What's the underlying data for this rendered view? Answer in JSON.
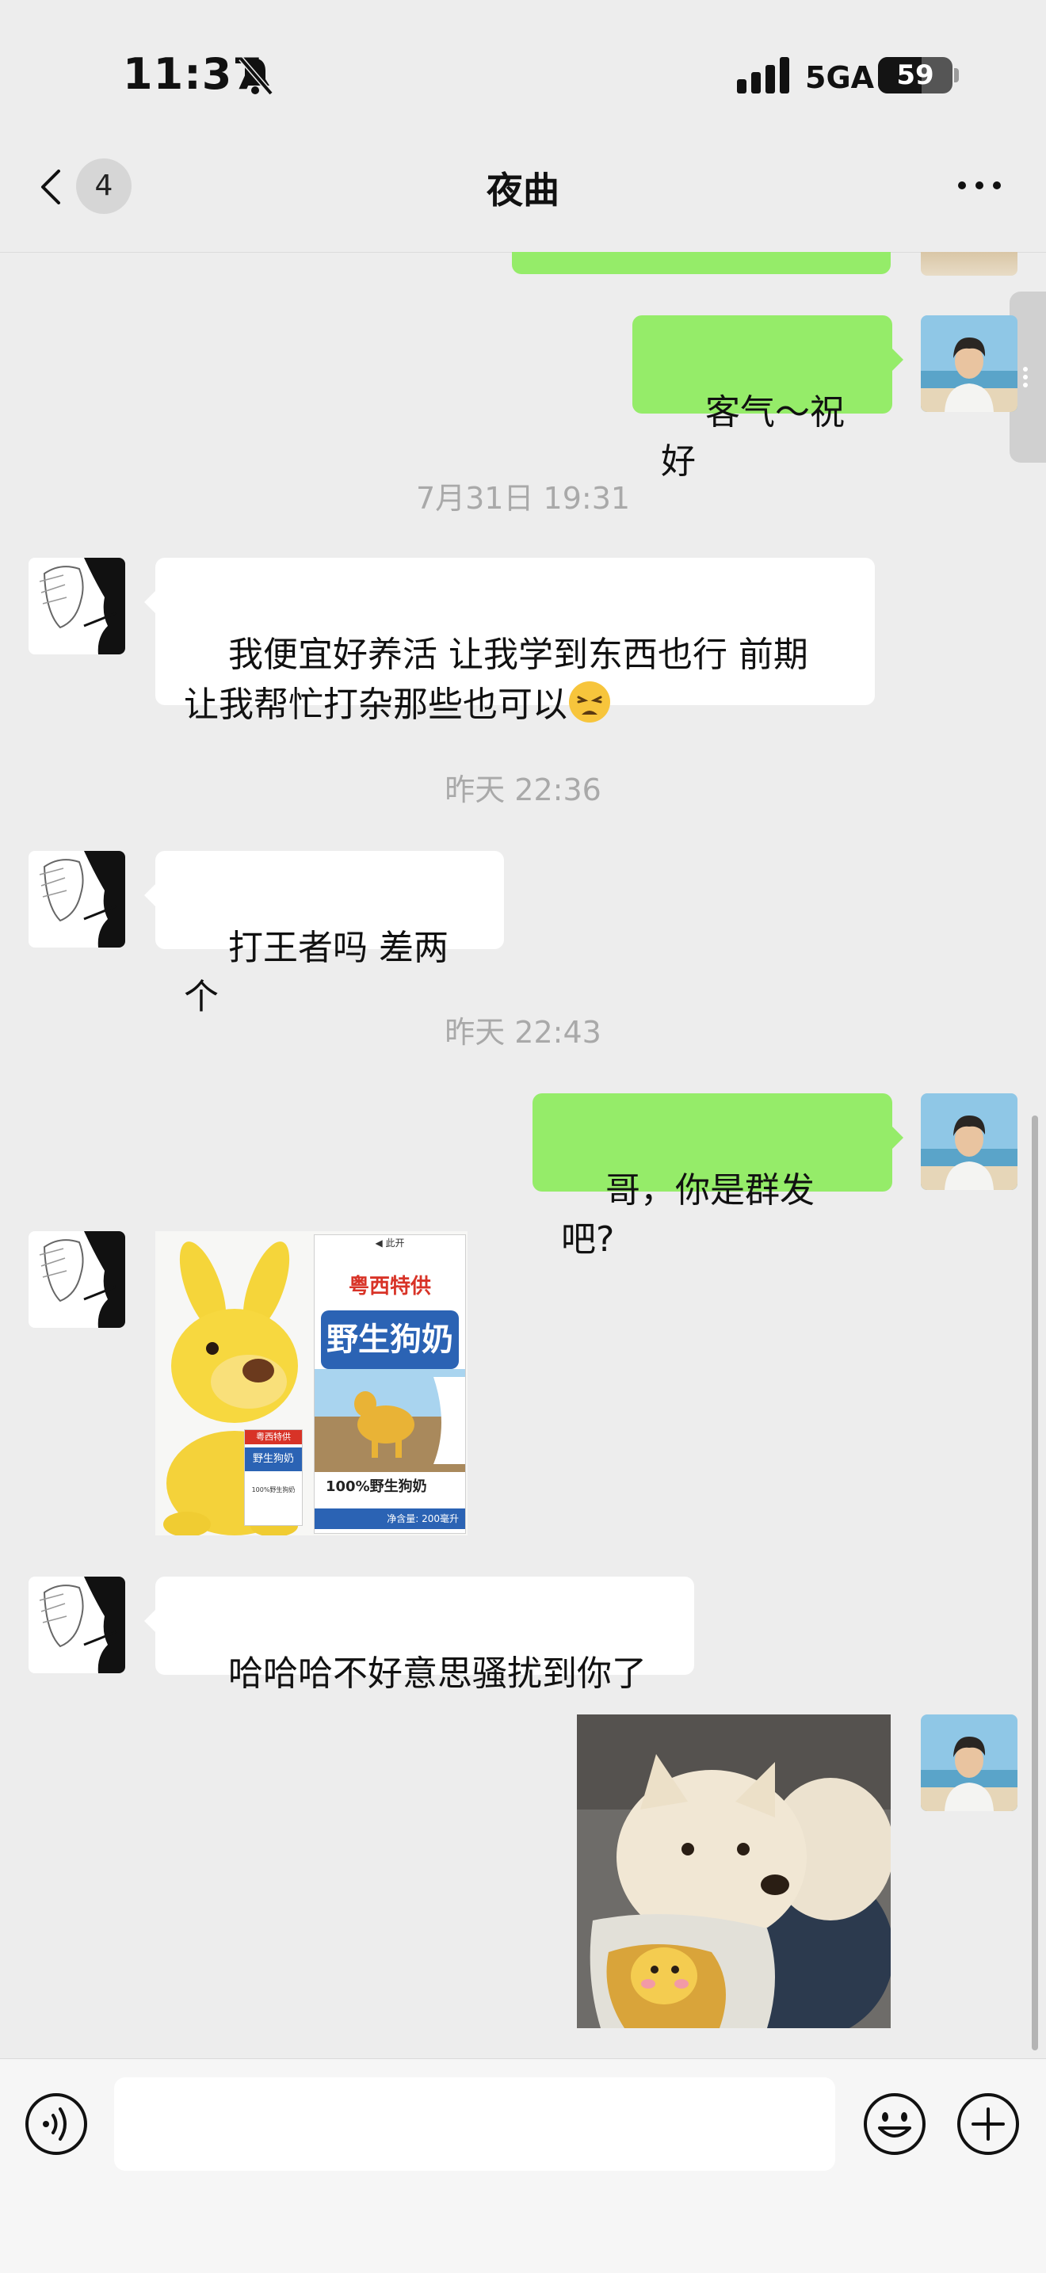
{
  "status_bar": {
    "time": "11:37",
    "network": "5GA",
    "battery_level": "59",
    "battery_fraction": 0.59
  },
  "nav": {
    "unread_count": "4",
    "title": "夜曲"
  },
  "messages": [
    {
      "side": "right",
      "type": "text",
      "text": ""
    },
    {
      "side": "right",
      "type": "text",
      "text": "客气～祝好"
    },
    {
      "type": "timestamp",
      "text": "7月31日 19:31"
    },
    {
      "side": "left",
      "type": "text",
      "text": "我便宜好养活 让我学到东西也行 前期\n让我帮忙打杂那些也可以",
      "emoji": "tired-face-emoji"
    },
    {
      "type": "timestamp",
      "text": "昨天 22:36"
    },
    {
      "side": "left",
      "type": "text",
      "text": "打王者吗 差两个"
    },
    {
      "type": "timestamp",
      "text": "昨天 22:43"
    },
    {
      "side": "right",
      "type": "text",
      "text": "哥，你是群发吧?"
    },
    {
      "side": "left",
      "type": "image",
      "image": {
        "brand": "粤西特供",
        "product": "野生狗奶",
        "percent_label": "100%野生狗奶",
        "volume": "净含量: 200毫升",
        "small_brand": "粤西特供",
        "small_product": "野生狗奶",
        "small_percent": "100%野生狗奶",
        "top_label": "◀ 此开"
      }
    },
    {
      "side": "left",
      "type": "text",
      "text": "哈哈哈不好意思骚扰到你了"
    },
    {
      "side": "right",
      "type": "image",
      "image": {
        "description_icon": "fluffy-dog-sticker"
      }
    }
  ],
  "input_bar": {
    "placeholder": ""
  },
  "icons": {
    "back": "chevron-left-icon",
    "more": "more-dots-icon",
    "mute": "bell-slash-icon",
    "voice": "voice-icon",
    "emoji": "smiley-icon",
    "plus": "plus-icon"
  },
  "colors": {
    "background": "#ededed",
    "bubble_green": "#95ec69",
    "bubble_white": "#ffffff",
    "timestamp": "#a9a9a9"
  }
}
